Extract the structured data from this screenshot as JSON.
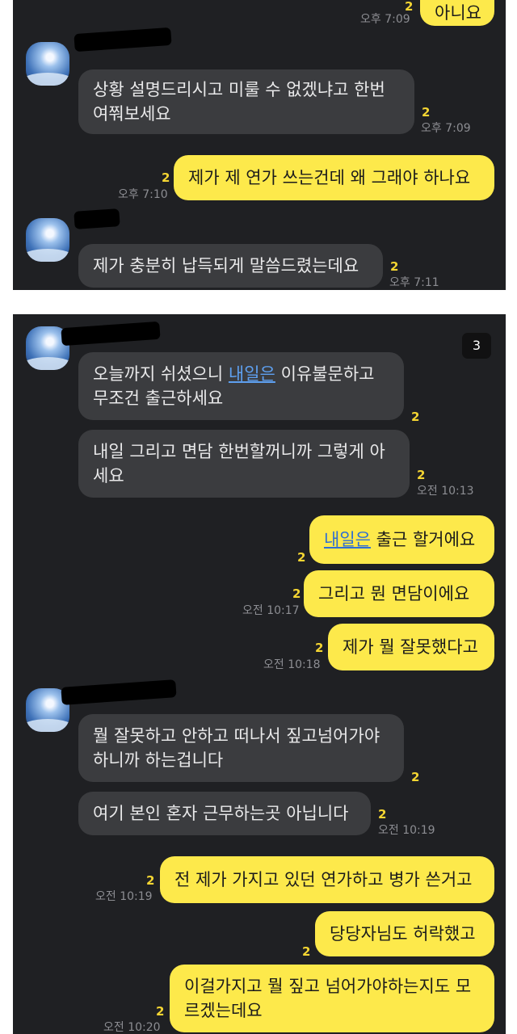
{
  "panel1": {
    "top_bubble": {
      "text": "아니요",
      "unread": "2",
      "time": "오후 7:09"
    },
    "m1": {
      "lines": [
        "상황 설명드리시고 미룰 수 없겠냐고 한번",
        "여쭤보세요"
      ],
      "unread": "2",
      "time": "오후 7:09"
    },
    "m2": {
      "text": "제가 제 연가 쓰는건데 왜 그래야 하나요",
      "unread": "2",
      "time": "오후 7:10"
    },
    "m3": {
      "text": "제가 충분히 납득되게 말씀드렸는데요",
      "unread": "2",
      "time": "오후 7:11"
    }
  },
  "panel2": {
    "badge": "3",
    "m1": {
      "line1_link": "내일은",
      "line1_pre": "오늘까지 쉬셨으니 ",
      "line1_post": " 이유불문하고",
      "line2": "무조건 출근하세요",
      "unread": "2"
    },
    "m2": {
      "lines": [
        "내일 그리고 면담 한번할꺼니까 그렇게 아",
        "세요"
      ],
      "unread": "2",
      "time": "오전 10:13"
    },
    "m3": {
      "link": "내일은",
      "rest": " 출근 할거에요",
      "unread": "2"
    },
    "m4": {
      "text": "그리고 뭔 면담이에요",
      "unread": "2",
      "time": "오전 10:17"
    },
    "m5": {
      "text": "제가 뭘 잘못했다고",
      "unread": "2",
      "time": "오전 10:18"
    },
    "m6": {
      "lines": [
        "뭘 잘못하고 안하고 떠나서 짚고넘어가야",
        "하니까 하는겁니다"
      ],
      "unread": "2"
    },
    "m7": {
      "text": "여기 본인 혼자 근무하는곳 아닙니다",
      "unread": "2",
      "time": "오전 10:19"
    },
    "m8": {
      "text": "전 제가 가지고 있던 연가하고 병가 쓴거고",
      "unread": "2",
      "time": "오전 10:19"
    },
    "m9": {
      "text": "당당자님도 허락했고",
      "unread": "2"
    },
    "m10": {
      "lines": [
        "이걸가지고 뭘 짚고 넘어가야하는지도 모",
        "르겠는데요"
      ],
      "unread": "2",
      "time": "오전 10:20"
    }
  },
  "colors": {
    "background": "#1f2023",
    "incoming_bubble": "#3b3c3f",
    "outgoing_bubble": "#fde94b",
    "unread_count": "#f4d532",
    "link": "#5ea0f0"
  }
}
